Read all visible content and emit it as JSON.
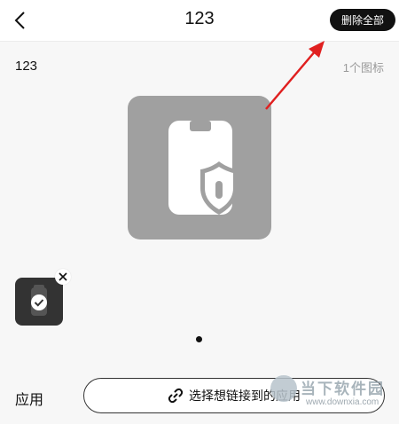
{
  "header": {
    "back_icon": "chevron-left-icon",
    "title": "123",
    "delete_all_label": "删除全部"
  },
  "group": {
    "name": "123",
    "icon_count": "1个图标"
  },
  "preview": {
    "icon": "phone-shield-icon",
    "tile_color": "#a0a0a0"
  },
  "thumbnails": [
    {
      "icon": "phone-check-icon",
      "remove_icon": "close-icon"
    }
  ],
  "pager": {
    "current": 1,
    "total": 1
  },
  "bottom": {
    "label": "应用",
    "link_icon": "link-icon",
    "link_button_label": "选择想链接到的应用"
  },
  "annotation": {
    "arrow_color": "#e02020",
    "arrow_target": "delete-all-button"
  },
  "watermark": {
    "name": "当下软件园",
    "url": "www.downxia.com"
  }
}
